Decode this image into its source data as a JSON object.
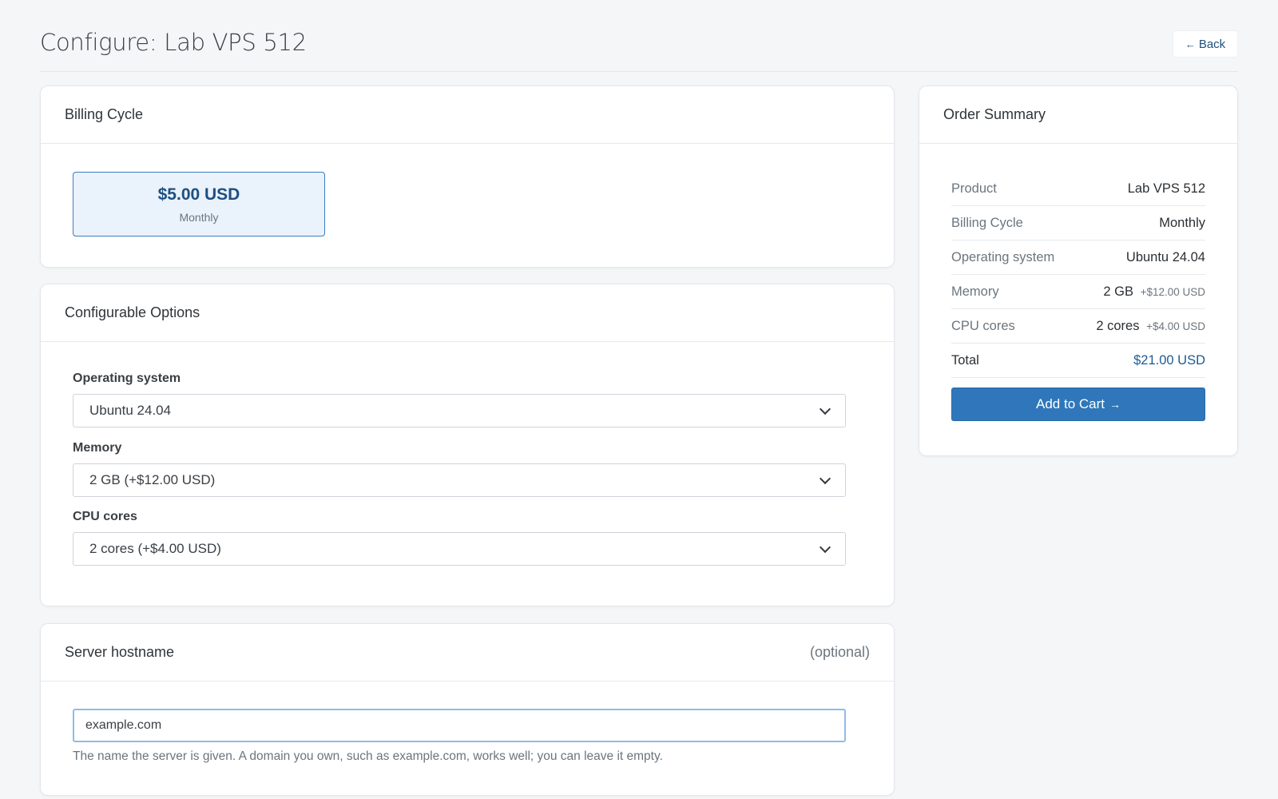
{
  "header": {
    "title": "Configure: Lab VPS 512",
    "back_arrow": "←",
    "back_label": "Back"
  },
  "billing": {
    "title": "Billing Cycle",
    "price": "$5.00 USD",
    "cycle": "Monthly"
  },
  "options": {
    "title": "Configurable Options",
    "fields": [
      {
        "label": "Operating system",
        "value": "Ubuntu 24.04"
      },
      {
        "label": "Memory",
        "value": "2 GB (+$12.00 USD)"
      },
      {
        "label": "CPU cores",
        "value": "2 cores (+$4.00 USD)"
      }
    ]
  },
  "hostname": {
    "title": "Server hostname",
    "optional": "(optional)",
    "value": "example.com",
    "help": "The name the server is given. A domain you own, such as example.com, works well; you can leave it empty."
  },
  "summary": {
    "title": "Order Summary",
    "rows": [
      {
        "key": "Product",
        "value": "Lab VPS 512",
        "extra": ""
      },
      {
        "key": "Billing Cycle",
        "value": "Monthly",
        "extra": ""
      },
      {
        "key": "Operating system",
        "value": "Ubuntu 24.04",
        "extra": ""
      },
      {
        "key": "Memory",
        "value": "2 GB",
        "extra": "+$12.00 USD"
      },
      {
        "key": "CPU cores",
        "value": "2 cores",
        "extra": "+$4.00 USD"
      }
    ],
    "total_label": "Total",
    "total_value": "$21.00 USD",
    "cart_label": "Add to Cart",
    "cart_arrow": "→"
  },
  "colors": {
    "accent": "#2f77ba",
    "selected_bg": "#eaf2fc",
    "page_bg": "#f4f6f8"
  }
}
